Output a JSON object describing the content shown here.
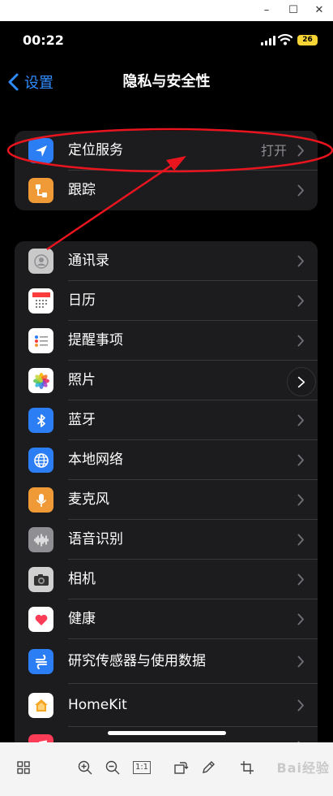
{
  "window": {
    "minimize_glyph": "–",
    "maximize_glyph": "☐",
    "close_glyph": "✕"
  },
  "status_bar": {
    "time": "00:22",
    "battery": "26",
    "battery_color": "#f7d435"
  },
  "nav": {
    "back_label": "设置",
    "title": "隐私与安全性",
    "accent_color": "#2f8cff"
  },
  "group1": [
    {
      "label": "定位服务",
      "value": "打开",
      "icon": "location-arrow-icon",
      "icon_bg": "#2c7ef5"
    },
    {
      "label": "跟踪",
      "value": "",
      "icon": "tracking-icon",
      "icon_bg": "#f09a37"
    }
  ],
  "group2": [
    {
      "label": "通讯录",
      "icon": "contacts-icon",
      "icon_bg": "#c9c9c9"
    },
    {
      "label": "日历",
      "icon": "calendar-icon",
      "icon_bg": "#ffffff"
    },
    {
      "label": "提醒事项",
      "icon": "reminders-icon",
      "icon_bg": "#ffffff"
    },
    {
      "label": "照片",
      "icon": "photos-icon",
      "icon_bg": "#ffffff"
    },
    {
      "label": "蓝牙",
      "icon": "bluetooth-icon",
      "icon_bg": "#2c7ef5"
    },
    {
      "label": "本地网络",
      "icon": "globe-icon",
      "icon_bg": "#2c7ef5"
    },
    {
      "label": "麦克风",
      "icon": "microphone-icon",
      "icon_bg": "#f09a37"
    },
    {
      "label": "语音识别",
      "icon": "waveform-icon",
      "icon_bg": "#8e8e93"
    },
    {
      "label": "相机",
      "icon": "camera-icon",
      "icon_bg": "#d0d0d0"
    },
    {
      "label": "健康",
      "icon": "heart-icon",
      "icon_bg": "#ffffff"
    },
    {
      "label": "研究传感器与使用数据",
      "icon": "research-icon",
      "icon_bg": "#2c7ef5"
    },
    {
      "label": "HomeKit",
      "icon": "home-icon",
      "icon_bg": "#ffffff"
    },
    {
      "label": "",
      "icon": "music-icon",
      "icon_bg": "#fa3c57"
    }
  ],
  "annotation": {
    "color": "#e8141e"
  },
  "toolbar": {
    "actual_size_label": "1:1",
    "watermark": "Bai经验"
  }
}
